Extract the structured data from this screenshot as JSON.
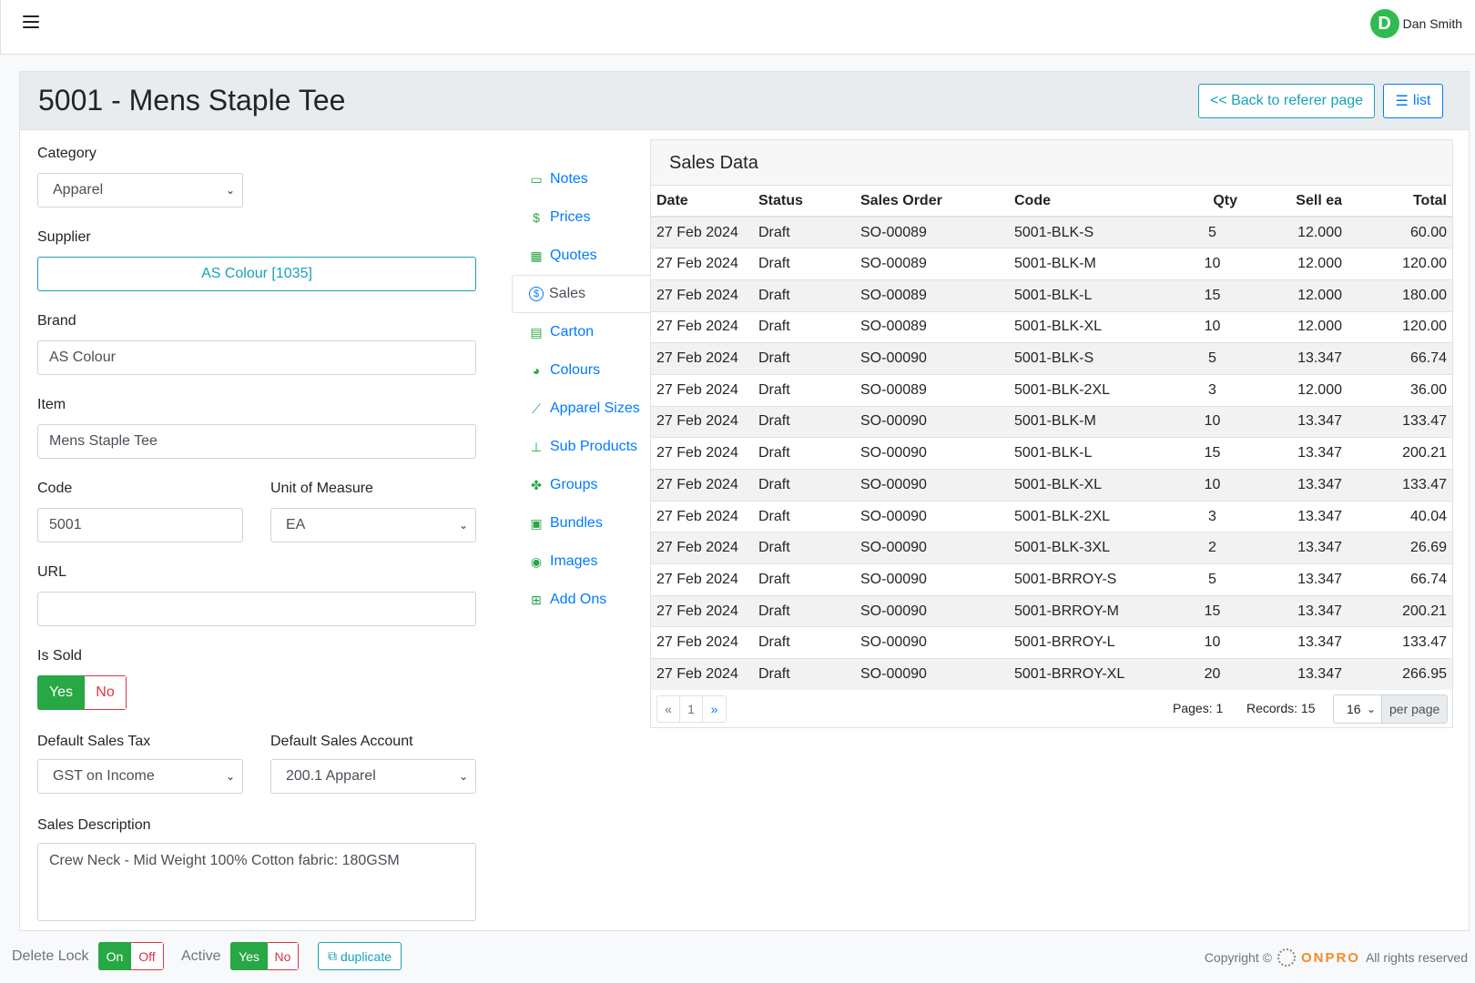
{
  "user": {
    "initial": "D",
    "name": "Dan Smith"
  },
  "page": {
    "title": "5001 - Mens Staple Tee",
    "back_label": "<< Back to referer page",
    "list_label": "list"
  },
  "form": {
    "category_label": "Category",
    "category_value": "Apparel",
    "supplier_label": "Supplier",
    "supplier_value": "AS Colour [1035]",
    "brand_label": "Brand",
    "brand_value": "AS Colour",
    "item_label": "Item",
    "item_value": "Mens Staple Tee",
    "code_label": "Code",
    "code_value": "5001",
    "uom_label": "Unit of Measure",
    "uom_value": "EA",
    "url_label": "URL",
    "url_value": "",
    "is_sold_label": "Is Sold",
    "yes_label": "Yes",
    "no_label": "No",
    "tax_label": "Default Sales Tax",
    "tax_value": "GST on Income",
    "account_label": "Default Sales Account",
    "account_value": "200.1 Apparel",
    "desc_label": "Sales Description",
    "desc_value": "Crew Neck - Mid Weight 100% Cotton fabric: 180GSM"
  },
  "tabs": [
    {
      "label": "Notes",
      "icon": "notes-icon",
      "glyph": "▭"
    },
    {
      "label": "Prices",
      "icon": "dollar-icon",
      "glyph": "$"
    },
    {
      "label": "Quotes",
      "icon": "table-icon",
      "glyph": "▦"
    },
    {
      "label": "Sales",
      "icon": "coin-icon",
      "glyph": "$"
    },
    {
      "label": "Carton",
      "icon": "calendar-icon",
      "glyph": "▤"
    },
    {
      "label": "Colours",
      "icon": "palette-icon",
      "glyph": "◕"
    },
    {
      "label": "Apparel Sizes",
      "icon": "ruler-icon",
      "glyph": "⟋"
    },
    {
      "label": "Sub Products",
      "icon": "diagram-icon",
      "glyph": "⊥"
    },
    {
      "label": "Groups",
      "icon": "boxes-icon",
      "glyph": "✤"
    },
    {
      "label": "Bundles",
      "icon": "images-icon",
      "glyph": "▣"
    },
    {
      "label": "Images",
      "icon": "camera-icon",
      "glyph": "◉"
    },
    {
      "label": "Add Ons",
      "icon": "plus-square-icon",
      "glyph": "⊞"
    }
  ],
  "sales": {
    "title": "Sales Data",
    "columns": [
      "Date",
      "Status",
      "Sales Order",
      "Code",
      "Qty",
      "Sell ea",
      "Total"
    ],
    "rows": [
      [
        "27 Feb 2024",
        "Draft",
        "SO-00089",
        "5001-BLK-S",
        "5",
        "12.000",
        "60.00"
      ],
      [
        "27 Feb 2024",
        "Draft",
        "SO-00089",
        "5001-BLK-M",
        "10",
        "12.000",
        "120.00"
      ],
      [
        "27 Feb 2024",
        "Draft",
        "SO-00089",
        "5001-BLK-L",
        "15",
        "12.000",
        "180.00"
      ],
      [
        "27 Feb 2024",
        "Draft",
        "SO-00089",
        "5001-BLK-XL",
        "10",
        "12.000",
        "120.00"
      ],
      [
        "27 Feb 2024",
        "Draft",
        "SO-00090",
        "5001-BLK-S",
        "5",
        "13.347",
        "66.74"
      ],
      [
        "27 Feb 2024",
        "Draft",
        "SO-00089",
        "5001-BLK-2XL",
        "3",
        "12.000",
        "36.00"
      ],
      [
        "27 Feb 2024",
        "Draft",
        "SO-00090",
        "5001-BLK-M",
        "10",
        "13.347",
        "133.47"
      ],
      [
        "27 Feb 2024",
        "Draft",
        "SO-00090",
        "5001-BLK-L",
        "15",
        "13.347",
        "200.21"
      ],
      [
        "27 Feb 2024",
        "Draft",
        "SO-00090",
        "5001-BLK-XL",
        "10",
        "13.347",
        "133.47"
      ],
      [
        "27 Feb 2024",
        "Draft",
        "SO-00090",
        "5001-BLK-2XL",
        "3",
        "13.347",
        "40.04"
      ],
      [
        "27 Feb 2024",
        "Draft",
        "SO-00090",
        "5001-BLK-3XL",
        "2",
        "13.347",
        "26.69"
      ],
      [
        "27 Feb 2024",
        "Draft",
        "SO-00090",
        "5001-BRROY-S",
        "5",
        "13.347",
        "66.74"
      ],
      [
        "27 Feb 2024",
        "Draft",
        "SO-00090",
        "5001-BRROY-M",
        "15",
        "13.347",
        "200.21"
      ],
      [
        "27 Feb 2024",
        "Draft",
        "SO-00090",
        "5001-BRROY-L",
        "10",
        "13.347",
        "133.47"
      ],
      [
        "27 Feb 2024",
        "Draft",
        "SO-00090",
        "5001-BRROY-XL",
        "20",
        "13.347",
        "266.95"
      ]
    ],
    "pager": {
      "prev": "«",
      "page": "1",
      "next": "»"
    },
    "pages_text": "Pages: 1",
    "records_text": "Records: 15",
    "per_page_value": "16",
    "per_page_label": "per page"
  },
  "footer": {
    "delete_lock_label": "Delete Lock",
    "on_label": "On",
    "off_label": "Off",
    "active_label": "Active",
    "yes_label": "Yes",
    "no_label": "No",
    "duplicate_label": "duplicate",
    "copyright_text": "Copyright ©",
    "brand": "ONPRO",
    "rights_text": "All rights reserved"
  },
  "colors": {
    "primary": "#007bff",
    "info": "#17a2b8",
    "success": "#28a745",
    "danger": "#dc3545",
    "brand_orange": "#f28c28"
  }
}
